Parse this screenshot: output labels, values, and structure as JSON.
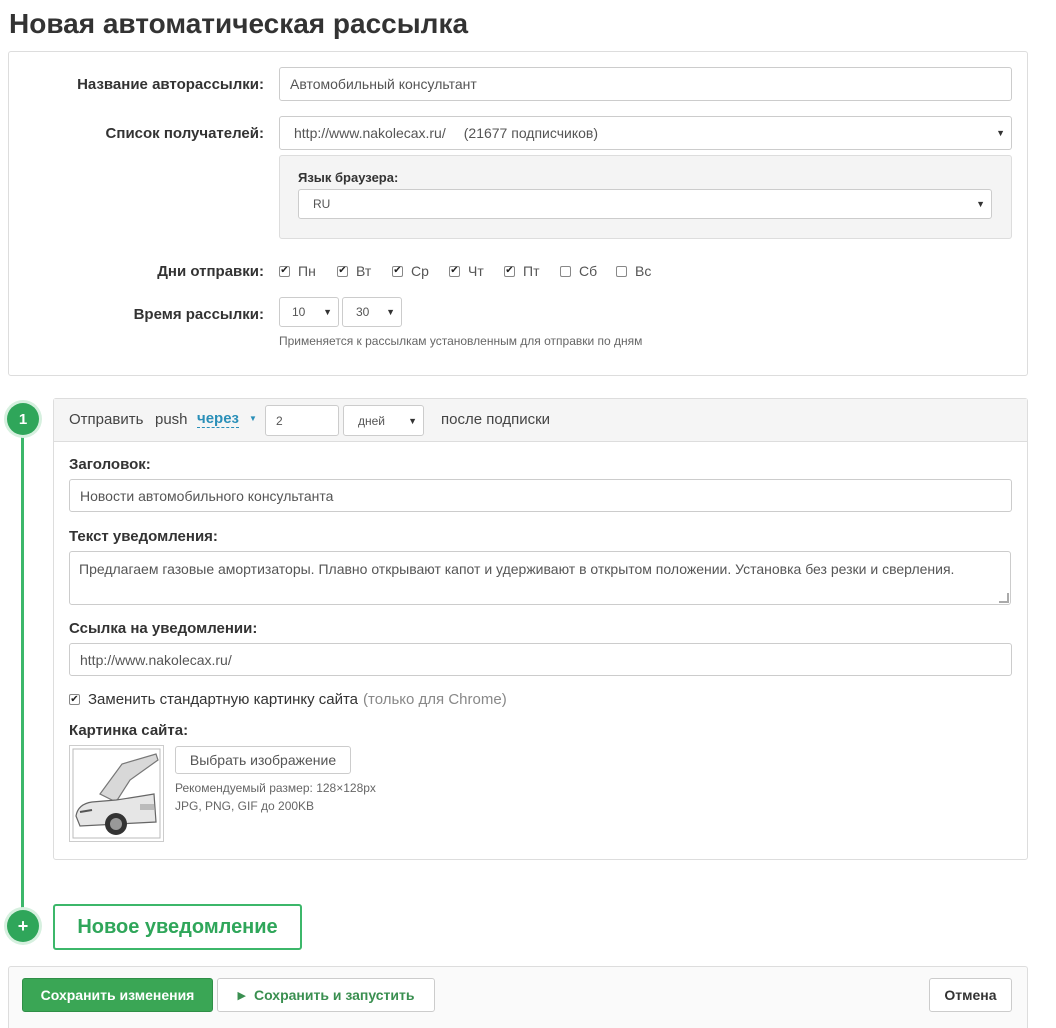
{
  "page": {
    "title": "Новая автоматическая рассылка"
  },
  "settings": {
    "name_label": "Название авторассылки:",
    "name_value": "Автомобильный консультант",
    "recipients_label": "Список получателей:",
    "recipients_value": "http://www.nakolecax.ru/",
    "recipients_count": "(21677 подписчиков)",
    "browser_lang_label": "Язык браузера:",
    "browser_lang_value": "RU",
    "days_label": "Дни отправки:",
    "days": [
      {
        "label": "Пн",
        "checked": true
      },
      {
        "label": "Вт",
        "checked": true
      },
      {
        "label": "Ср",
        "checked": true
      },
      {
        "label": "Чт",
        "checked": true
      },
      {
        "label": "Пт",
        "checked": true
      },
      {
        "label": "Сб",
        "checked": false
      },
      {
        "label": "Вс",
        "checked": false
      }
    ],
    "time_label": "Время рассылки:",
    "hour_value": "10",
    "minute_value": "30",
    "time_hint": "Применяется к рассылкам установленным для отправки по дням"
  },
  "step": {
    "number": "1",
    "send_text": "Отправить",
    "push_text": "push",
    "through_link": "через",
    "delay_value": "2",
    "unit_value": "дней",
    "after_text": "после подписки",
    "title_label": "Заголовок:",
    "title_value": "Новости автомобильного консультанта",
    "text_label": "Текст уведомления:",
    "text_value": "Предлагаем газовые амортизаторы. Плавно открывают капот и удерживают в открытом положении. Установка без резки и сверления.",
    "link_label": "Ссылка на уведомлении:",
    "link_value": "http://www.nakolecax.ru/",
    "replace_image_label": "Заменить стандартную картинку сайта",
    "replace_image_note": "(только для Chrome)",
    "replace_image_checked": true,
    "image_label": "Картинка сайта:",
    "choose_image_button": "Выбрать изображение",
    "recommended_size": "Рекомендуемый размер: 128×128px",
    "formats_hint": "JPG, PNG, GIF до 200KB"
  },
  "add_step": {
    "icon": "+",
    "label": "Новое уведомление"
  },
  "footer": {
    "save_button": "Сохранить изменения",
    "save_run_button": "Сохранить и запустить",
    "cancel_button": "Отмена"
  },
  "colors": {
    "accent": "#3aa655",
    "link": "#2a8fb8"
  }
}
